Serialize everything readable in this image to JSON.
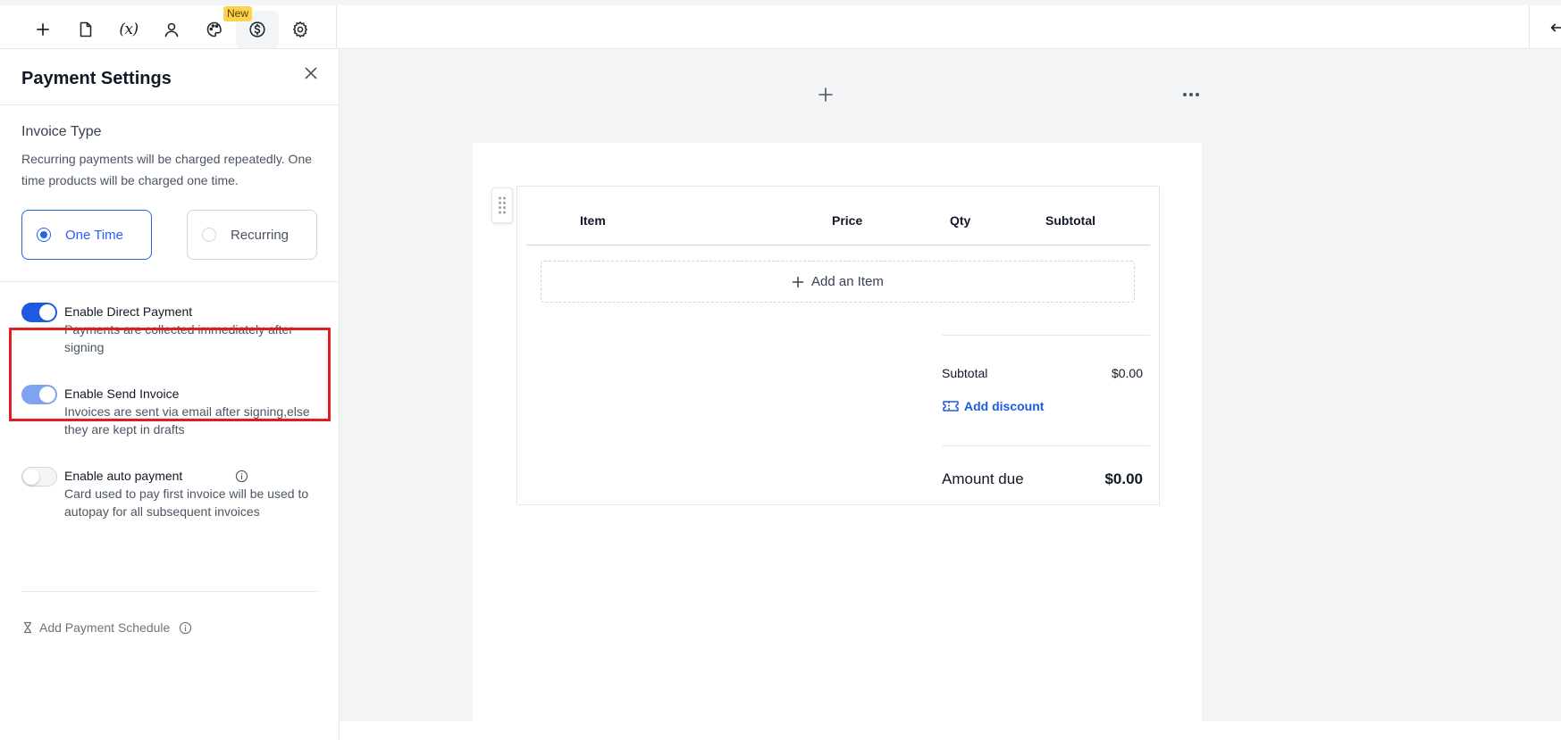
{
  "toolbar": {
    "icons": [
      "plus-icon",
      "document-icon",
      "variable-icon",
      "user-icon",
      "palette-icon",
      "dollar-circle-icon",
      "gear-icon"
    ],
    "variable_glyph": "(x)",
    "new_badge": "New",
    "active_icon": "dollar-circle-icon"
  },
  "panel": {
    "title": "Payment Settings",
    "invoice_type": {
      "title": "Invoice Type",
      "description": "Recurring payments will be charged repeatedly. One time products will be charged one time.",
      "options": [
        {
          "label": "One Time",
          "selected": true
        },
        {
          "label": "Recurring",
          "selected": false
        }
      ]
    },
    "toggles": [
      {
        "label": "Enable Direct Payment",
        "description": "Payments are collected immediately after signing",
        "state": "on"
      },
      {
        "label": "Enable Send Invoice",
        "description": "Invoices are sent via email after signing,else they are kept in drafts",
        "state": "on-disabled"
      },
      {
        "label": "Enable auto payment",
        "description": "Card used to pay first invoice will be used to autopay for all subsequent invoices",
        "state": "off"
      }
    ],
    "schedule_label": "Add Payment Schedule"
  },
  "table": {
    "headers": {
      "item": "Item",
      "price": "Price",
      "qty": "Qty",
      "subtotal": "Subtotal"
    },
    "add_item_label": "Add an Item",
    "summary": {
      "subtotal_label": "Subtotal",
      "subtotal_value": "$0.00",
      "discount_label": "Add discount",
      "amount_due_label": "Amount due",
      "amount_due_value": "$0.00"
    }
  },
  "colors": {
    "accent": "#1d5ae0",
    "highlight": "#e11d22",
    "badge": "#fcd34d",
    "canvas_bg": "#f3f4f6"
  }
}
